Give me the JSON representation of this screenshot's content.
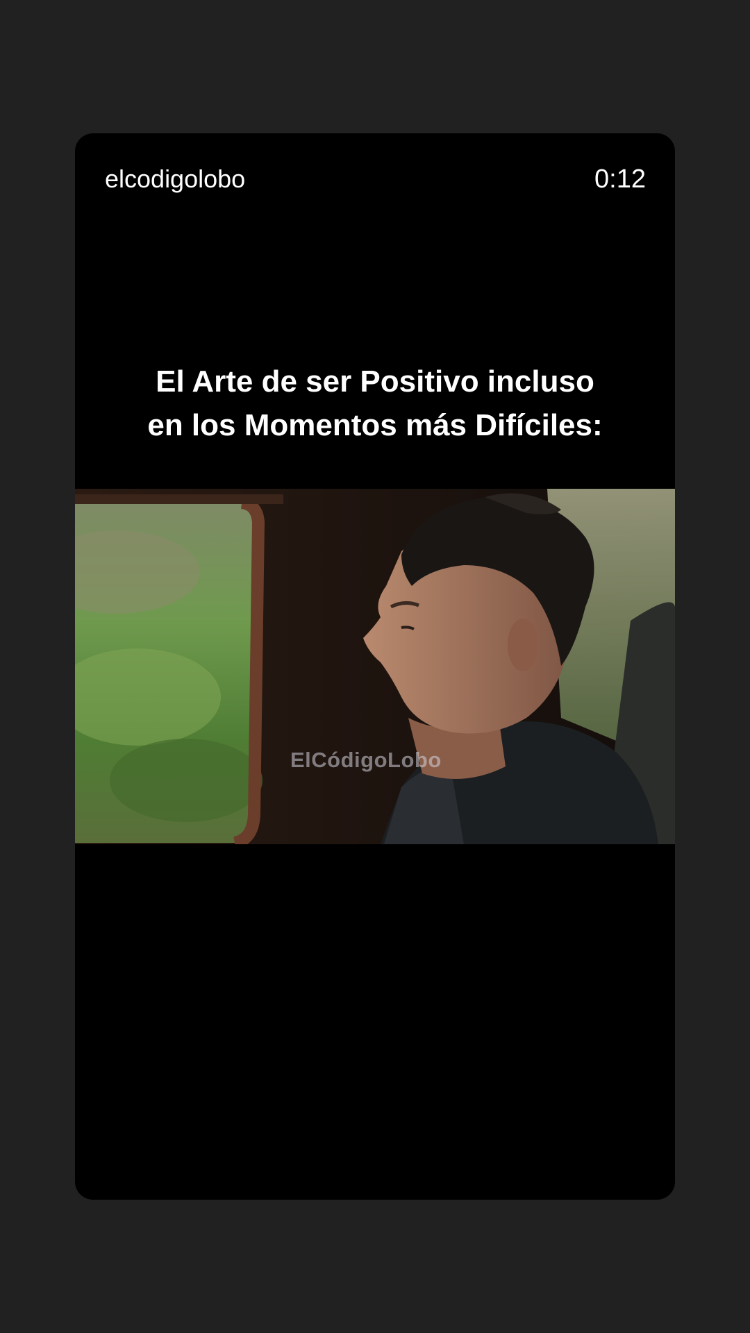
{
  "story": {
    "username": "elcodigolobo",
    "timestamp": "0:12",
    "title_lines": [
      "El Arte de ser Positivo incluso",
      "en los Momentos más Difíciles:"
    ],
    "watermark": "ElCódigoLobo"
  }
}
